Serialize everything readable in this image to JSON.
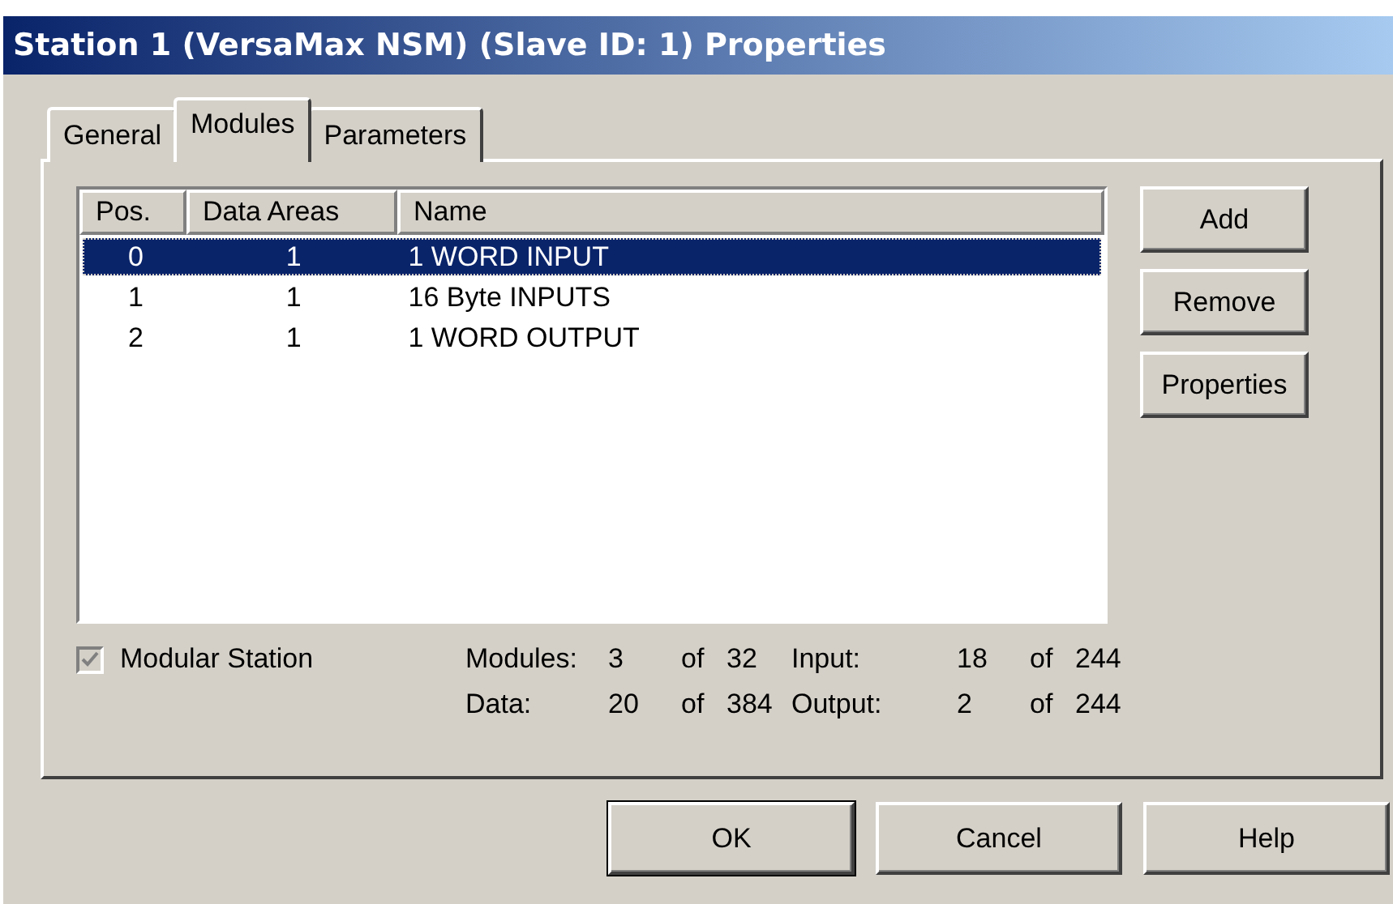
{
  "window": {
    "title": "Station 1 (VersaMax NSM) (Slave ID: 1) Properties"
  },
  "tabs": [
    {
      "label": "General",
      "selected": false
    },
    {
      "label": "Modules",
      "selected": true
    },
    {
      "label": "Parameters",
      "selected": false
    }
  ],
  "table": {
    "columns": [
      "Pos.",
      "Data Areas",
      "Name"
    ],
    "rows": [
      {
        "cells": [
          "0",
          "1",
          "1 WORD INPUT"
        ],
        "selected": true
      },
      {
        "cells": [
          "1",
          "1",
          "16 Byte INPUTS"
        ],
        "selected": false
      },
      {
        "cells": [
          "2",
          "1",
          "1 WORD OUTPUT"
        ],
        "selected": false
      }
    ]
  },
  "side_buttons": [
    "Add",
    "Remove",
    "Properties"
  ],
  "modular_station": {
    "label": "Modular Station",
    "checked": true,
    "disabled": true
  },
  "stats": [
    {
      "label": "Modules:",
      "value": "3",
      "of": "of",
      "max": "32"
    },
    {
      "label": "Input:",
      "value": "18",
      "of": "of",
      "max": "244"
    },
    {
      "label": "Data:",
      "value": "20",
      "of": "of",
      "max": "384"
    },
    {
      "label": "Output:",
      "value": "2",
      "of": "of",
      "max": "244"
    }
  ],
  "buttons": [
    "OK",
    "Cancel",
    "Help"
  ]
}
